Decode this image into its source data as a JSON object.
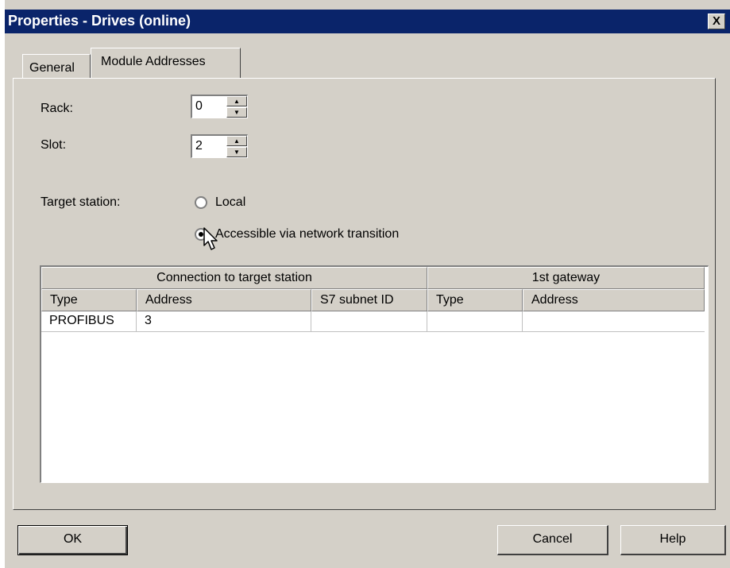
{
  "window": {
    "title": "Properties - Drives (online)",
    "close_label": "X"
  },
  "tabs": [
    {
      "label": "General"
    },
    {
      "label": "Module Addresses"
    }
  ],
  "fields": {
    "rack": {
      "label": "Rack:",
      "value": "0"
    },
    "slot": {
      "label": "Slot:",
      "value": "2"
    }
  },
  "target_station": {
    "label": "Target station:",
    "options": [
      {
        "label": "Local",
        "selected": false
      },
      {
        "label": "Accessible via network transition",
        "selected": true
      }
    ]
  },
  "table": {
    "group_headers": [
      "Connection to target station",
      "1st gateway"
    ],
    "columns": [
      "Type",
      "Address",
      "S7 subnet ID",
      "Type",
      "Address"
    ],
    "rows": [
      [
        "PROFIBUS",
        "3",
        "",
        "",
        ""
      ]
    ]
  },
  "buttons": {
    "ok": "OK",
    "cancel": "Cancel",
    "help": "Help"
  }
}
